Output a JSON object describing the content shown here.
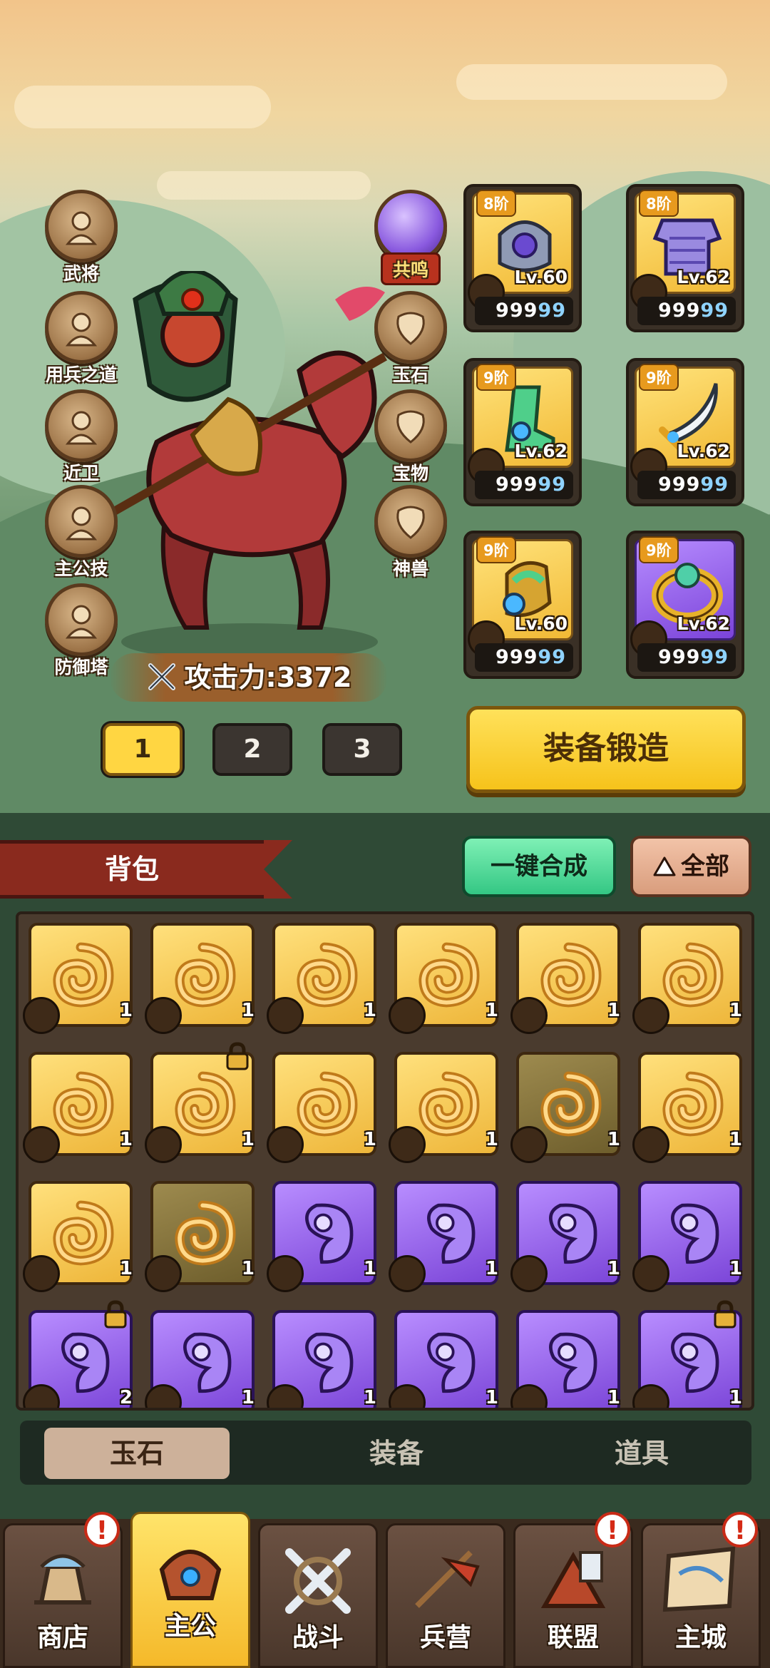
{
  "side_menu_left": [
    {
      "label": "武将",
      "icon": "general-icon"
    },
    {
      "label": "用兵之道",
      "icon": "tactics-icon"
    },
    {
      "label": "近卫",
      "icon": "guard-icon"
    },
    {
      "label": "主公技",
      "icon": "lord-skill-icon"
    },
    {
      "label": "防御塔",
      "icon": "tower-icon"
    }
  ],
  "side_menu_right": [
    {
      "label": "共鸣",
      "icon": "resonance-orb-icon"
    },
    {
      "label": "玉石",
      "icon": "jade-icon"
    },
    {
      "label": "宝物",
      "icon": "treasure-icon"
    },
    {
      "label": "神兽",
      "icon": "beast-icon"
    }
  ],
  "attack_power": {
    "label": "攻击力:",
    "value": "3372"
  },
  "equipment": [
    {
      "tier": "8阶",
      "level": "Lv.60",
      "value": "99999",
      "icon": "shoulder-armor-icon",
      "rarity": "gold"
    },
    {
      "tier": "8阶",
      "level": "Lv.62",
      "value": "99999",
      "icon": "chest-armor-icon",
      "rarity": "gold"
    },
    {
      "tier": "9阶",
      "level": "Lv.62",
      "value": "99999",
      "icon": "boots-icon",
      "rarity": "gold"
    },
    {
      "tier": "9阶",
      "level": "Lv.62",
      "value": "99999",
      "icon": "scimitar-icon",
      "rarity": "gold"
    },
    {
      "tier": "9阶",
      "level": "Lv.60",
      "value": "99999",
      "icon": "gauntlet-icon",
      "rarity": "gold"
    },
    {
      "tier": "9阶",
      "level": "Lv.62",
      "value": "99999",
      "icon": "ring-icon",
      "rarity": "purple"
    }
  ],
  "pages": [
    "1",
    "2",
    "3"
  ],
  "active_page": "1",
  "forge_button": "装备锻造",
  "bag": {
    "title": "背包",
    "merge_button": "一键合成",
    "filter_button": "全部",
    "items": [
      {
        "count": "1",
        "rarity": "gold",
        "dim": false,
        "lock": false
      },
      {
        "count": "1",
        "rarity": "gold",
        "dim": false,
        "lock": false
      },
      {
        "count": "1",
        "rarity": "gold",
        "dim": false,
        "lock": false
      },
      {
        "count": "1",
        "rarity": "gold",
        "dim": false,
        "lock": false
      },
      {
        "count": "1",
        "rarity": "gold",
        "dim": false,
        "lock": false
      },
      {
        "count": "1",
        "rarity": "gold",
        "dim": false,
        "lock": false
      },
      {
        "count": "1",
        "rarity": "gold",
        "dim": false,
        "lock": false
      },
      {
        "count": "1",
        "rarity": "gold",
        "dim": false,
        "lock": true
      },
      {
        "count": "1",
        "rarity": "gold",
        "dim": false,
        "lock": false
      },
      {
        "count": "1",
        "rarity": "gold",
        "dim": false,
        "lock": false
      },
      {
        "count": "1",
        "rarity": "gold",
        "dim": true,
        "lock": false
      },
      {
        "count": "1",
        "rarity": "gold",
        "dim": false,
        "lock": false
      },
      {
        "count": "1",
        "rarity": "gold",
        "dim": false,
        "lock": false
      },
      {
        "count": "1",
        "rarity": "gold",
        "dim": true,
        "lock": false
      },
      {
        "count": "1",
        "rarity": "purple",
        "dim": false,
        "lock": false
      },
      {
        "count": "1",
        "rarity": "purple",
        "dim": false,
        "lock": false
      },
      {
        "count": "1",
        "rarity": "purple",
        "dim": false,
        "lock": false
      },
      {
        "count": "1",
        "rarity": "purple",
        "dim": false,
        "lock": false
      },
      {
        "count": "2",
        "rarity": "purple",
        "dim": false,
        "lock": true
      },
      {
        "count": "1",
        "rarity": "purple",
        "dim": false,
        "lock": false
      },
      {
        "count": "1",
        "rarity": "purple",
        "dim": false,
        "lock": false
      },
      {
        "count": "1",
        "rarity": "purple",
        "dim": false,
        "lock": false
      },
      {
        "count": "1",
        "rarity": "purple",
        "dim": false,
        "lock": false
      },
      {
        "count": "1",
        "rarity": "purple",
        "dim": false,
        "lock": true
      }
    ]
  },
  "bag_tabs": [
    "玉石",
    "装备",
    "道具"
  ],
  "active_bag_tab": "玉石",
  "bottom_nav": [
    {
      "label": "商店",
      "icon": "shop-icon",
      "alert": true
    },
    {
      "label": "主公",
      "icon": "lord-icon",
      "alert": false,
      "active": true
    },
    {
      "label": "战斗",
      "icon": "battle-icon",
      "alert": false
    },
    {
      "label": "兵营",
      "icon": "barracks-icon",
      "alert": false
    },
    {
      "label": "联盟",
      "icon": "alliance-icon",
      "alert": true
    },
    {
      "label": "主城",
      "icon": "city-icon",
      "alert": true
    }
  ],
  "colors": {
    "gold": "#f1b935",
    "purple": "#7b43d9",
    "accent_yellow": "#ffd642",
    "green_button": "#34c784"
  }
}
